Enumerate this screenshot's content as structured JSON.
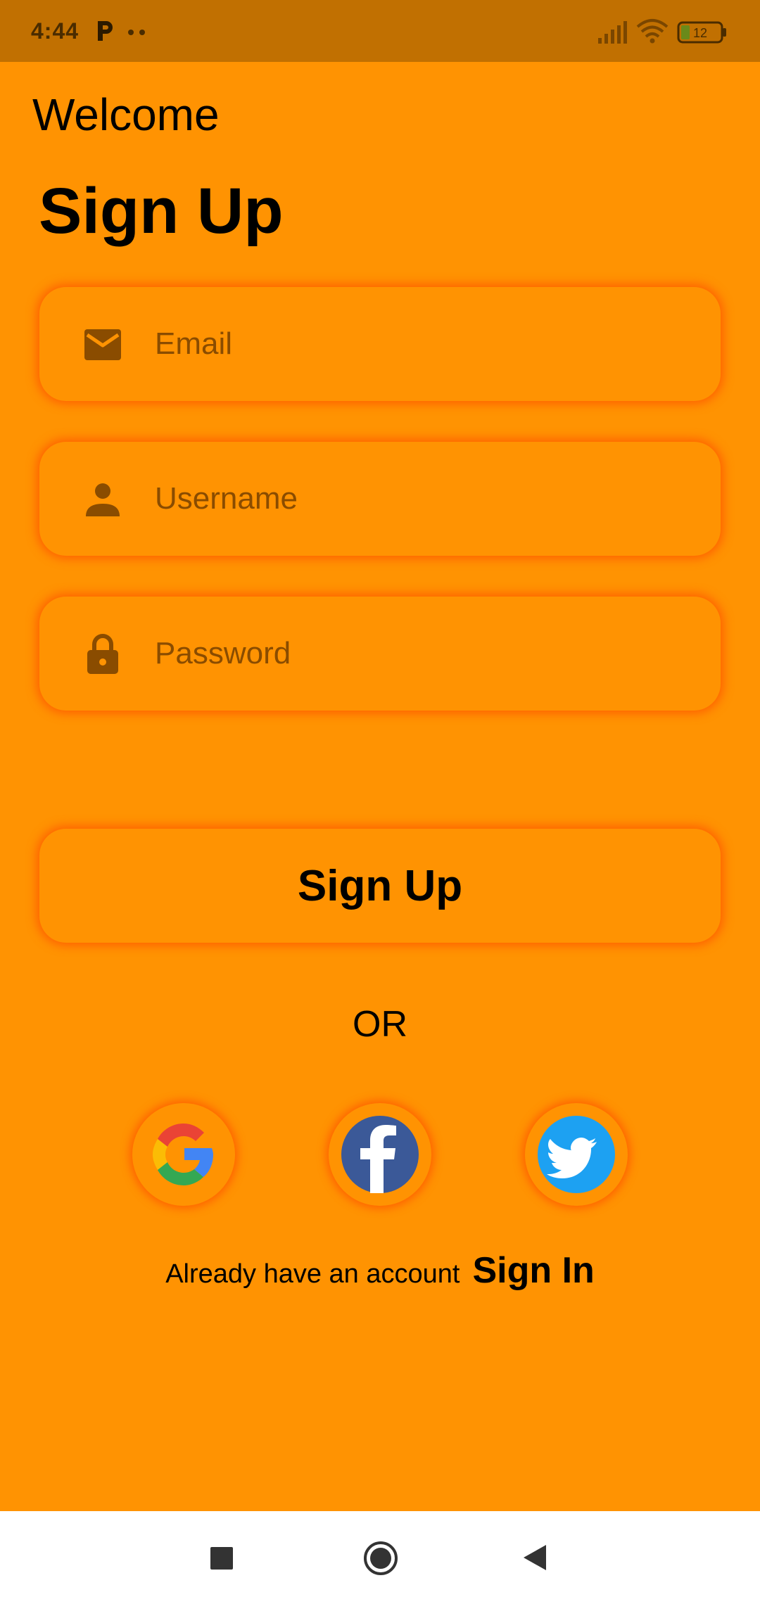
{
  "status_bar": {
    "time": "4:44",
    "battery": "12"
  },
  "header": {
    "welcome": "Welcome",
    "title": "Sign Up"
  },
  "form": {
    "email_placeholder": "Email",
    "username_placeholder": "Username",
    "password_placeholder": "Password",
    "submit_label": "Sign Up"
  },
  "divider_text": "OR",
  "social": {
    "providers": [
      "google-icon",
      "facebook-icon",
      "twitter-icon"
    ]
  },
  "footer": {
    "account_text": "Already have an account",
    "signin_label": "Sign In"
  },
  "colors": {
    "background": "#FF9302",
    "status_bar": "#C17001",
    "glow": "#FF5800",
    "icon": "#8a4c00"
  }
}
